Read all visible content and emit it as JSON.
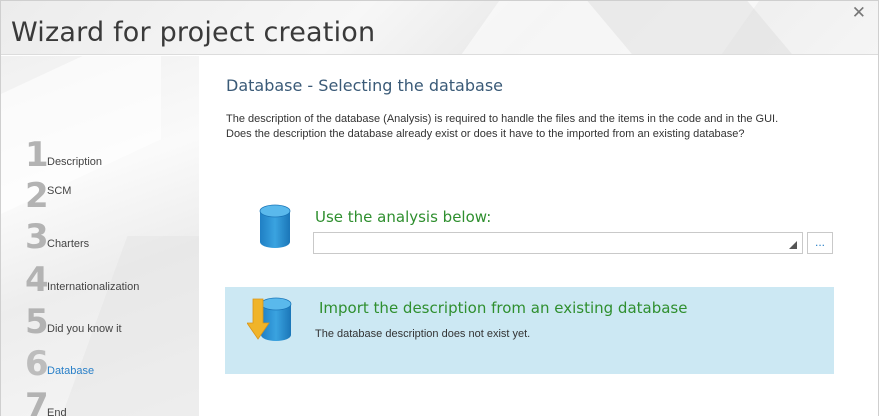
{
  "window": {
    "title": "Wizard for project creation",
    "close_glyph": "✕"
  },
  "sidebar": {
    "steps": [
      {
        "number": "1",
        "label": "Description",
        "active": false
      },
      {
        "number": "2",
        "label": "SCM",
        "active": false
      },
      {
        "number": "3",
        "label": "Charters",
        "active": false
      },
      {
        "number": "4",
        "label": "Internationalization",
        "active": false
      },
      {
        "number": "5",
        "label": "Did you know it",
        "active": false
      },
      {
        "number": "6",
        "label": "Database",
        "active": true
      },
      {
        "number": "7",
        "label": "End",
        "active": false
      }
    ]
  },
  "main": {
    "heading": "Database - Selecting the database",
    "description_line1": "The description of the database (Analysis) is required to handle the files and the items in the code and in the GUI.",
    "description_line2": "Does the description the database already exist or does it have to the imported from an existing database?",
    "use_analysis": {
      "title": "Use the analysis below:",
      "combo_value": "",
      "browse_label": "...",
      "icon": "database-icon"
    },
    "import_option": {
      "title": "Import the description from an existing database",
      "subtitle": "The database description does not exist yet.",
      "icon": "database-import-icon"
    }
  },
  "colors": {
    "accent_blue": "#2a80c8",
    "option_green": "#2f8f2f",
    "import_panel_bg": "#cce8f3",
    "import_arrow": "#f0b429"
  }
}
